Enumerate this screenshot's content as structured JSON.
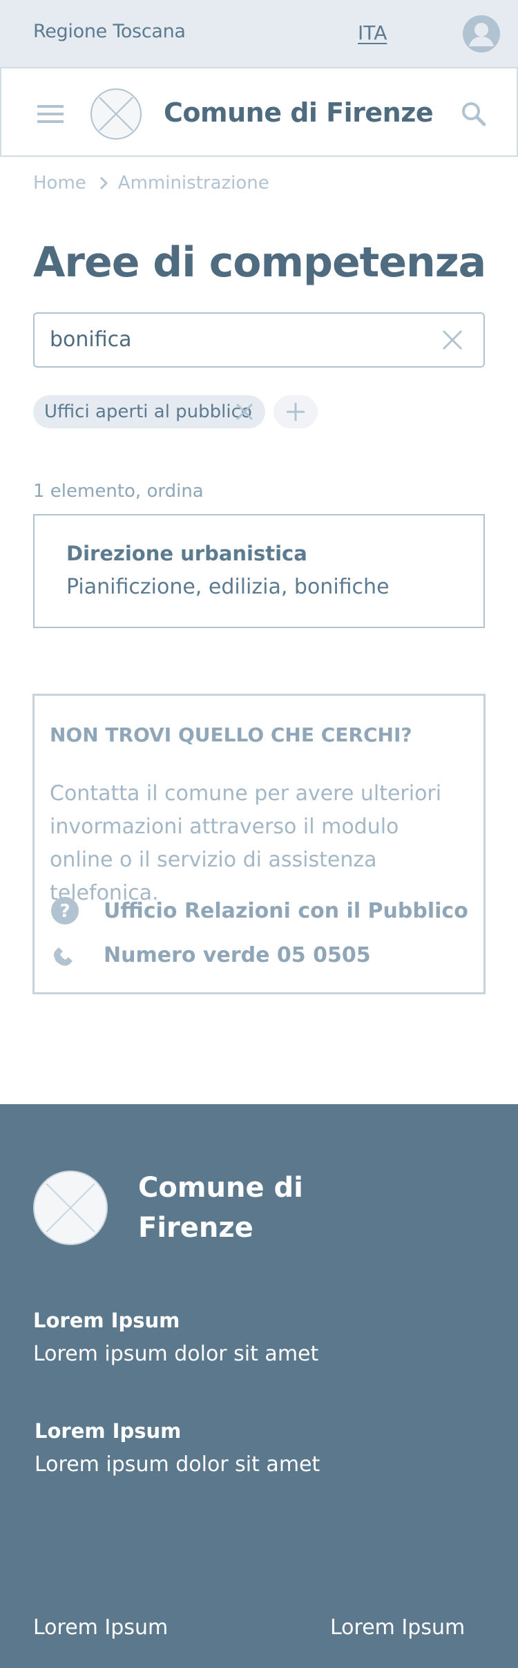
{
  "topbar": {
    "region": "Regione Toscana",
    "language": "ITA"
  },
  "header": {
    "site_title": "Comune di Firenze"
  },
  "breadcrumb": {
    "items": [
      "Home",
      "Amministrazione"
    ]
  },
  "page": {
    "title": "Aree di competenza"
  },
  "search": {
    "value": "bonifica"
  },
  "filters": {
    "chips": [
      "Uffici aperti al pubblico"
    ]
  },
  "results": {
    "count_label": "1 elemento, ordina",
    "items": [
      {
        "title": "Direzione urbanistica",
        "description": "Pianificzione, edilizia, bonifiche"
      }
    ]
  },
  "help_box": {
    "heading": "NON TROVI QUELLO CHE CERCHI?",
    "text": "Contatta il comune per avere ulteriori invormazioni attraverso il modulo online o il servizio di assistenza telefonica.",
    "links": [
      {
        "icon": "question-circle-icon",
        "label": "Ufficio Relazioni con il Pubblico"
      },
      {
        "icon": "phone-icon",
        "label": "Numero verde 05 0505"
      }
    ]
  },
  "footer": {
    "title": "Comune di Firenze",
    "blocks": [
      {
        "title": "Lorem Ipsum",
        "text": "Lorem ipsum dolor sit amet"
      },
      {
        "title": "Lorem Ipsum",
        "text": "Lorem ipsum dolor sit amet"
      }
    ],
    "bottom_links": [
      "Lorem Ipsum",
      "Lorem Ipsum"
    ]
  },
  "colors": {
    "primary_text": "#4f6b80",
    "muted": "#b1c3d1",
    "topbar_bg": "#e6ebf2",
    "footer_bg": "#5c788c"
  }
}
